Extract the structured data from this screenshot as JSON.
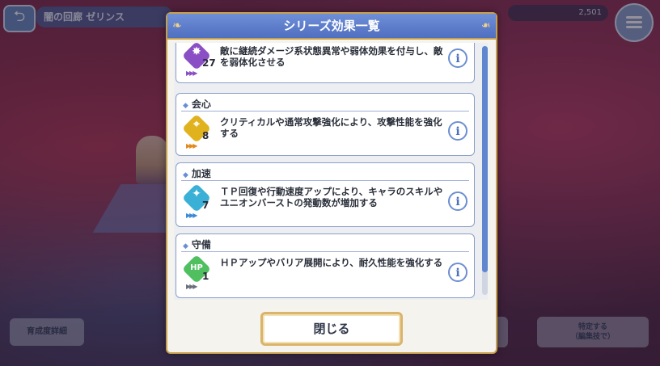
{
  "background": {
    "hud_title": "闇の回廊 ゼリンス",
    "stamina": "2,501",
    "left_button": "育成度詳細",
    "right_button_line1": "特定する",
    "right_button_line2": "（編集技で）"
  },
  "modal": {
    "title": "シリーズ効果一覧",
    "close_label": "閉じる",
    "cards": [
      {
        "title": "",
        "description": "敵に継続ダメージ系状態異常や弱体効果を付与し、敵を弱体化させる",
        "count": "27",
        "icon": "debuff-star-icon",
        "icon_color": "#8a4fc4",
        "arrow_color": "#8a4fc4",
        "info": "i"
      },
      {
        "title": "会心",
        "description": "クリティカルや通常攻撃強化により、攻撃性能を強化する",
        "count": "8",
        "icon": "crosshair-icon",
        "icon_color": "#e0b21e",
        "arrow_color": "#e08a1e",
        "info": "i"
      },
      {
        "title": "加速",
        "description": "ＴＰ回復や行動速度アップにより、キャラのスキルやユニオンバーストの発動数が増加する",
        "count": "7",
        "icon": "sparkle-icon",
        "icon_color": "#3bb0d6",
        "arrow_color": "#3b8ad6",
        "info": "i"
      },
      {
        "title": "守備",
        "description": "ＨＰアップやバリア展開により、耐久性能を強化する",
        "count": "1",
        "icon": "hp-shield-icon",
        "icon_color": "#4fbf5f",
        "arrow_color": "#6a6f7a",
        "info": "i"
      }
    ]
  }
}
